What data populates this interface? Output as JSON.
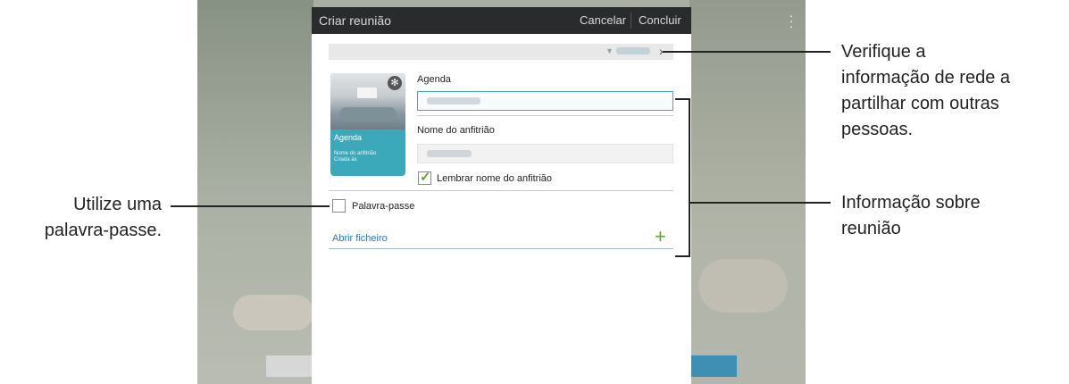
{
  "dialog": {
    "title": "Criar reunião",
    "cancel_label": "Cancelar",
    "done_label": "Concluir"
  },
  "thumbnail": {
    "title": "Agenda",
    "host_line": "Nome do anfitrião",
    "created_line": "Criada às"
  },
  "form": {
    "agenda_label": "Agenda",
    "host_label": "Nome do anfitrião",
    "remember_host_label": "Lembrar nome do anfitrião",
    "remember_host_checked": true,
    "password_label": "Palavra-passe",
    "password_checked": false,
    "open_file_label": "Abrir ficheiro"
  },
  "callouts": {
    "network_info": [
      "Verifique a",
      "informação de rede a",
      "partilhar com outras",
      "pessoas."
    ],
    "meeting_info": [
      "Informação sobre",
      "reunião"
    ],
    "password": [
      "Utilize uma",
      "palavra-passe."
    ]
  },
  "icons": {
    "gear": "gear-icon",
    "chevron": "chevron-right-icon",
    "wifi": "wifi-icon",
    "plus": "plus-icon",
    "check": "checkmark-icon",
    "overflow": "overflow-menu-icon"
  },
  "colors": {
    "titlebar": "#2a2b2c",
    "accent_field": "#44a4c6",
    "thumbnail": "#3ba9b9",
    "check_green": "#5aa832",
    "link_blue": "#2d73b6"
  }
}
